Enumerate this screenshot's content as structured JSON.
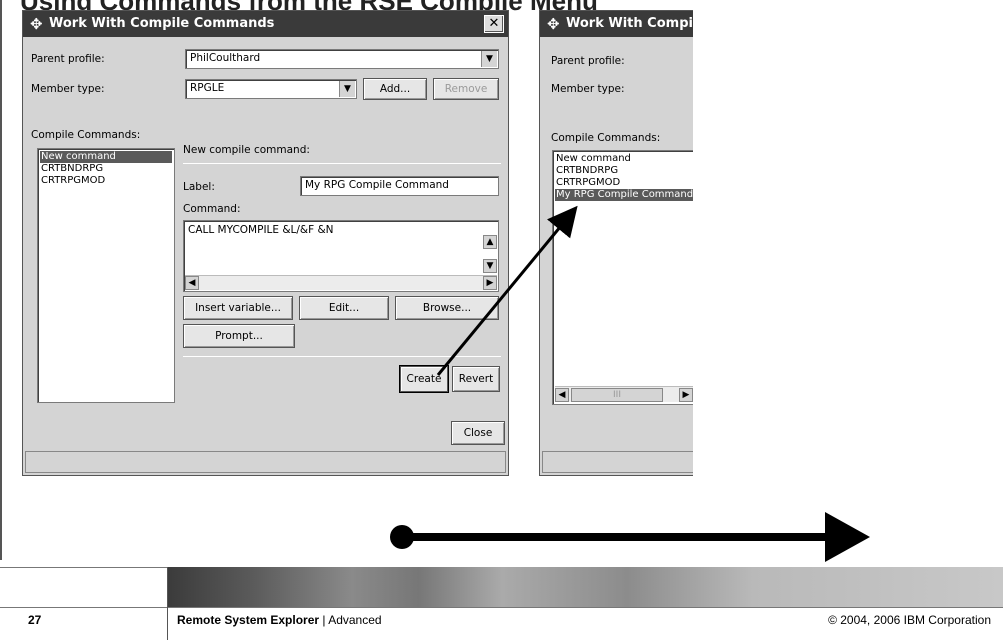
{
  "slide": {
    "title": "Using Commands from the RSE Compile Menu",
    "page_number": "27",
    "footer_title": "Remote System Explorer",
    "footer_separator": " | ",
    "footer_subtitle": "Advanced",
    "copyright": "© 2004, 2006 IBM Corporation"
  },
  "dialog_left": {
    "title": "Work With Compile Commands",
    "parent_profile_label": "Parent profile:",
    "parent_profile_value": "PhilCoulthard",
    "member_type_label": "Member type:",
    "member_type_value": "RPGLE",
    "add_button": "Add...",
    "remove_button": "Remove",
    "compile_commands_label": "Compile Commands:",
    "commands": [
      "New command",
      "CRTBNDRPG",
      "CRTRPGMOD"
    ],
    "selected_index": 0,
    "new_compile_command_label": "New compile command:",
    "label_field_label": "Label:",
    "label_field_value": "My RPG Compile Command",
    "command_label": "Command:",
    "command_value": "CALL MYCOMPILE &L/&F &N",
    "insert_variable_button": "Insert variable...",
    "edit_button": "Edit...",
    "browse_button": "Browse...",
    "prompt_button": "Prompt...",
    "create_button": "Create",
    "revert_button": "Revert",
    "close_button": "Close"
  },
  "dialog_right": {
    "title": "Work With Compile",
    "parent_profile_label": "Parent profile:",
    "member_type_label": "Member type:",
    "compile_commands_label": "Compile Commands:",
    "commands": [
      "New command",
      "CRTBNDRPG",
      "CRTRPGMOD",
      "My RPG Compile Command"
    ],
    "selected_index": 3,
    "scroll_thumb": "III"
  },
  "icons": {
    "title_icon": "✥",
    "close_glyph": "✕",
    "dropdown_glyph": "▼",
    "scroll_up": "▲",
    "scroll_down": "▼",
    "scroll_left": "◀",
    "scroll_right": "▶"
  }
}
